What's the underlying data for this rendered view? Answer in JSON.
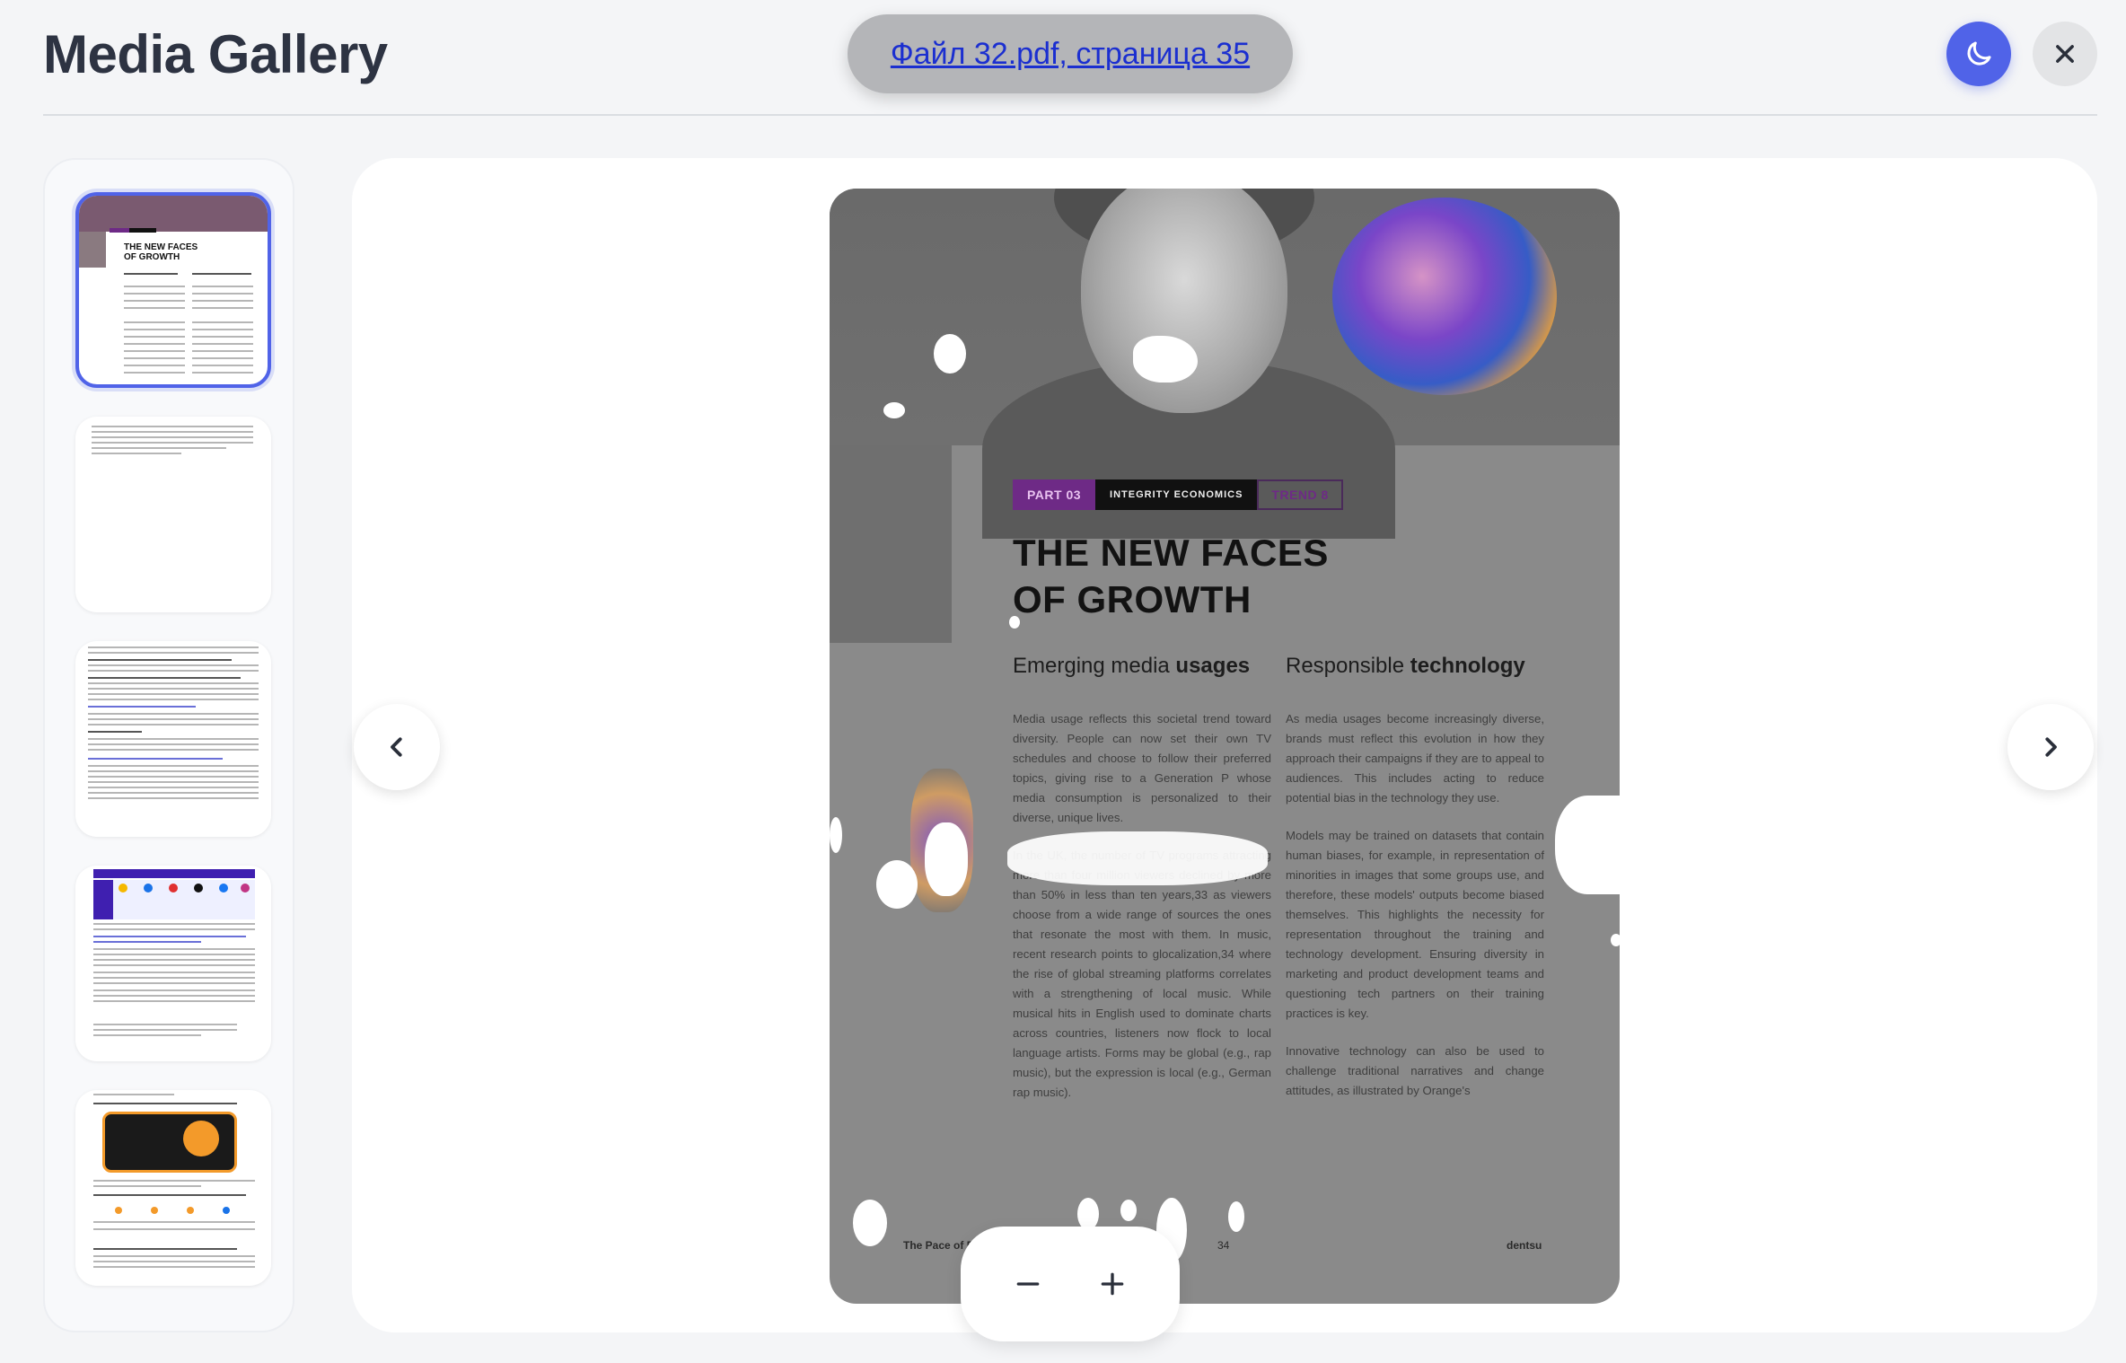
{
  "app": {
    "title": "Media Gallery"
  },
  "file": {
    "label": "Файл 32.pdf, страница 35"
  },
  "controls": {
    "theme_icon": "moon-icon",
    "close_icon": "close-icon",
    "prev_icon": "chevron-left-icon",
    "next_icon": "chevron-right-icon",
    "zoom_out_icon": "minus-icon",
    "zoom_in_icon": "plus-icon"
  },
  "colors": {
    "accent": "#5063e8",
    "tag_purple": "#6e2a86"
  },
  "thumbnails": [
    {
      "page": "1",
      "active": true
    },
    {
      "page": "2",
      "active": false
    },
    {
      "page": "3",
      "active": false
    },
    {
      "page": "4",
      "active": false
    },
    {
      "page": "5",
      "active": false
    }
  ],
  "page": {
    "tag_part": "PART 03",
    "tag_integrity": "INTEGRITY ECONOMICS",
    "tag_trend": "TREND 8",
    "title_line1": "THE NEW FACES",
    "title_line2": "OF GROWTH",
    "col1_heading_normal": "Emerging media ",
    "col1_heading_bold": "usages",
    "col2_heading_normal": "Responsible ",
    "col2_heading_bold": "technology",
    "col1_p1": "Media usage reflects this societal trend toward diversity. People can now set their own TV schedules and choose to follow their preferred topics, giving rise to a Generation P whose media consumption is personalized to their diverse, unique lives.",
    "col1_p2": "In the UK, the number of TV programs attracting more than four million viewers declined by more than 50% in less than ten years,33 as viewers choose from a wide range of sources the ones that resonate the most with them. In music, recent research points to glocalization,34 where the rise of global streaming platforms correlates with a strengthening of local music. While musical hits in English used to dominate charts across countries, listeners now flock to local language artists. Forms may be global (e.g., rap music), but the expression is local (e.g., German rap music).",
    "col2_p1": "As media usages become increasingly diverse, brands must reflect this evolution in how they approach their campaigns if they are to appeal to audiences. This includes acting to reduce potential bias in the technology they use.",
    "col2_p2": "Models may be trained on datasets that contain human biases, for example, in representation of minorities in images that some groups use, and therefore, these models' outputs become biased themselves. This highlights the necessity for representation throughout the training and technology development. Ensuring diversity in marketing and product development teams and questioning tech partners on their training practices is key.",
    "col2_p3": "Innovative technology can also be used to challenge traditional narratives and change attitudes, as illustrated by Orange's",
    "footer_left": "The Pace of P",
    "footer_page": "34",
    "footer_brand": "dentsu"
  }
}
